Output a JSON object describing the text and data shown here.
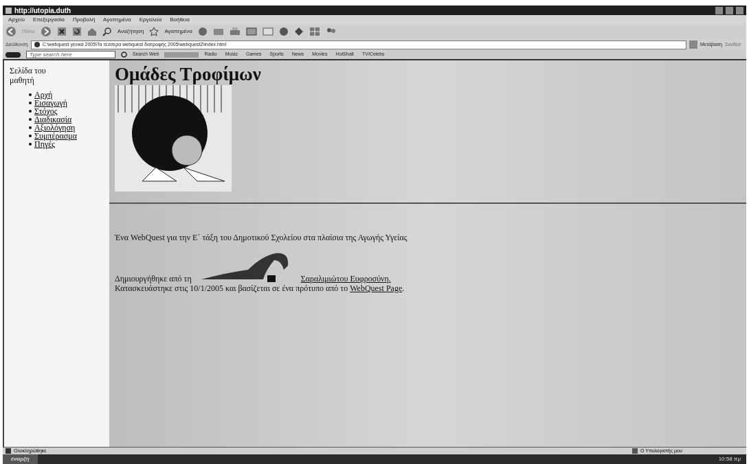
{
  "window": {
    "title": "http://utopia.duth"
  },
  "menu": [
    "Αρχείο",
    "Επεξεργασία",
    "Προβολή",
    "Αγαπημένα",
    "Εργαλεία",
    "Βοήθεια"
  ],
  "toolbar": {
    "back": "Πίσω",
    "search": "Αναζήτηση",
    "favorites": "Αγαπημένα"
  },
  "address": {
    "label": "Διεύθυνση",
    "value": "C:\\webquest γενικά 2005\\Τα τέσσερα webquest διατροφής 2005\\webquest2\\index.html",
    "go": "Μετάβαση",
    "links": "Συνδέσ"
  },
  "links_bar": {
    "search_placeholder": "Type search here",
    "search_web": "Search Web",
    "items": [
      "Radio",
      "Music",
      "Games",
      "Sports",
      "News",
      "Movies",
      "HotShall",
      "TV/Celebs"
    ]
  },
  "sidebar": {
    "title": "Σελίδα του μαθητή",
    "items": [
      "Αρχή",
      "Εισαγωγή",
      "Στόχος",
      "Διαδικασία",
      "Αξιολόγηση",
      "Συμπέρασμα",
      "Πηγές"
    ]
  },
  "page": {
    "heading": "Ομάδες Τροφίμων",
    "intro": "Ένα WebQuest για την Ε΄ τάξη του Δημοτικού Σχολείου στα πλαίσια της Αγωγής Υγείας",
    "created_by": "Δημιουργήθηκε από τη",
    "author": "Σαραλιμιώτου Ευφροσύνη.",
    "built": "Κατασκευάστηκε στις 10/1/2005 και βασίζεται σε ένα πρότυπο από το",
    "template_link": "WebQuest Page",
    "end": "."
  },
  "status_bar": {
    "left": "Ολοκληρώθηκε",
    "right": "Ο Υπολογιστής μου"
  },
  "taskbar": {
    "start": "έναρξη",
    "clock": "10:58 πμ"
  }
}
